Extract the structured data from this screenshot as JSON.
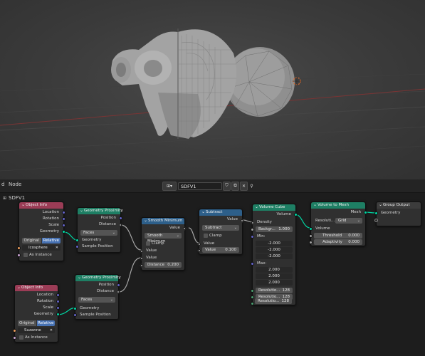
{
  "header": {
    "menu_view": "d",
    "menu_node": "Node",
    "tree_name": "SDFV1",
    "tree_icon": "node-tree-icon",
    "fake_user_icon": "shield-icon",
    "duplicate_icon": "copy-icon",
    "unlink_icon": "close-icon",
    "pin_icon": "pin-icon",
    "tree_icon_glyph": "⊞▾",
    "shield_glyph": "⛉",
    "copy_glyph": "⧉",
    "close_glyph": "✕",
    "pin_glyph": "⚲"
  },
  "breadcrumb": {
    "label": "SDFV1",
    "icon_glyph": "⊞"
  },
  "colors": {
    "object_header": "#9b3c56",
    "geometry_header": "#1e7f64",
    "math_header": "#2d5f8a",
    "geometry_socket": "#00d6a3",
    "value_socket": "#a1a1a1",
    "vector_socket": "#6363c7",
    "object_socket": "#ed9e5c",
    "bool_socket": "#cca6d6",
    "link": "#a6a6a6",
    "geo_link": "#00d6a3"
  },
  "nodes": {
    "object_info_1": {
      "title": "Object Info",
      "location": "Location",
      "rotation": "Rotation",
      "scale": "Scale",
      "geometry": "Geometry",
      "original": "Original",
      "relative": "Relative",
      "object": "Icosphere",
      "as_instance": "As Instance"
    },
    "geo_prox_1": {
      "title": "Geometry Proximity",
      "position": "Position",
      "distance": "Distance",
      "target": "Faces",
      "geometry": "Geometry",
      "sample_position": "Sample Position"
    },
    "smooth_min": {
      "title": "Smooth Minimum",
      "value_out": "Value",
      "operation": "Smooth Minimum",
      "clamp": "Clamp",
      "value_a": "Value",
      "value_b": "Value",
      "distance_label": "Distance",
      "distance_value": "0.200"
    },
    "subtract": {
      "title": "Subtract",
      "value_out": "Value",
      "operation": "Subtract",
      "clamp": "Clamp",
      "value_a": "Value",
      "value_b_label": "Value",
      "value_b": "0.100"
    },
    "volume_cube": {
      "title": "Volume Cube",
      "volume": "Volume",
      "density": "Density",
      "background_label": "Backgr...",
      "background_value": "1.000",
      "min": "Min:",
      "min_values": [
        "-2.000",
        "-2.000",
        "-2.000"
      ],
      "max": "Max:",
      "max_values": [
        "2.000",
        "2.000",
        "2.000"
      ],
      "resolution_label": "Resolutio...",
      "resolutions": [
        "128",
        "128",
        "128"
      ]
    },
    "volume_to_mesh": {
      "title": "Volume to Mesh",
      "mesh": "Mesh",
      "resolution_label": "Resoluti...",
      "resolution_mode": "Grid",
      "volume": "Volume",
      "threshold_label": "Threshold",
      "threshold_value": "0.000",
      "adaptivity_label": "Adaptivity",
      "adaptivity_value": "0.000"
    },
    "group_output": {
      "title": "Group Output",
      "geometry": "Geometry"
    },
    "object_info_2": {
      "title": "Object Info",
      "location": "Location",
      "rotation": "Rotation",
      "scale": "Scale",
      "geometry": "Geometry",
      "original": "Original",
      "relative": "Relative",
      "object": "Suzanne",
      "as_instance": "As Instance"
    },
    "geo_prox_2": {
      "title": "Geometry Proximity",
      "position": "Position",
      "distance": "Distance",
      "target": "Faces",
      "geometry": "Geometry",
      "sample_position": "Sample Position"
    }
  }
}
